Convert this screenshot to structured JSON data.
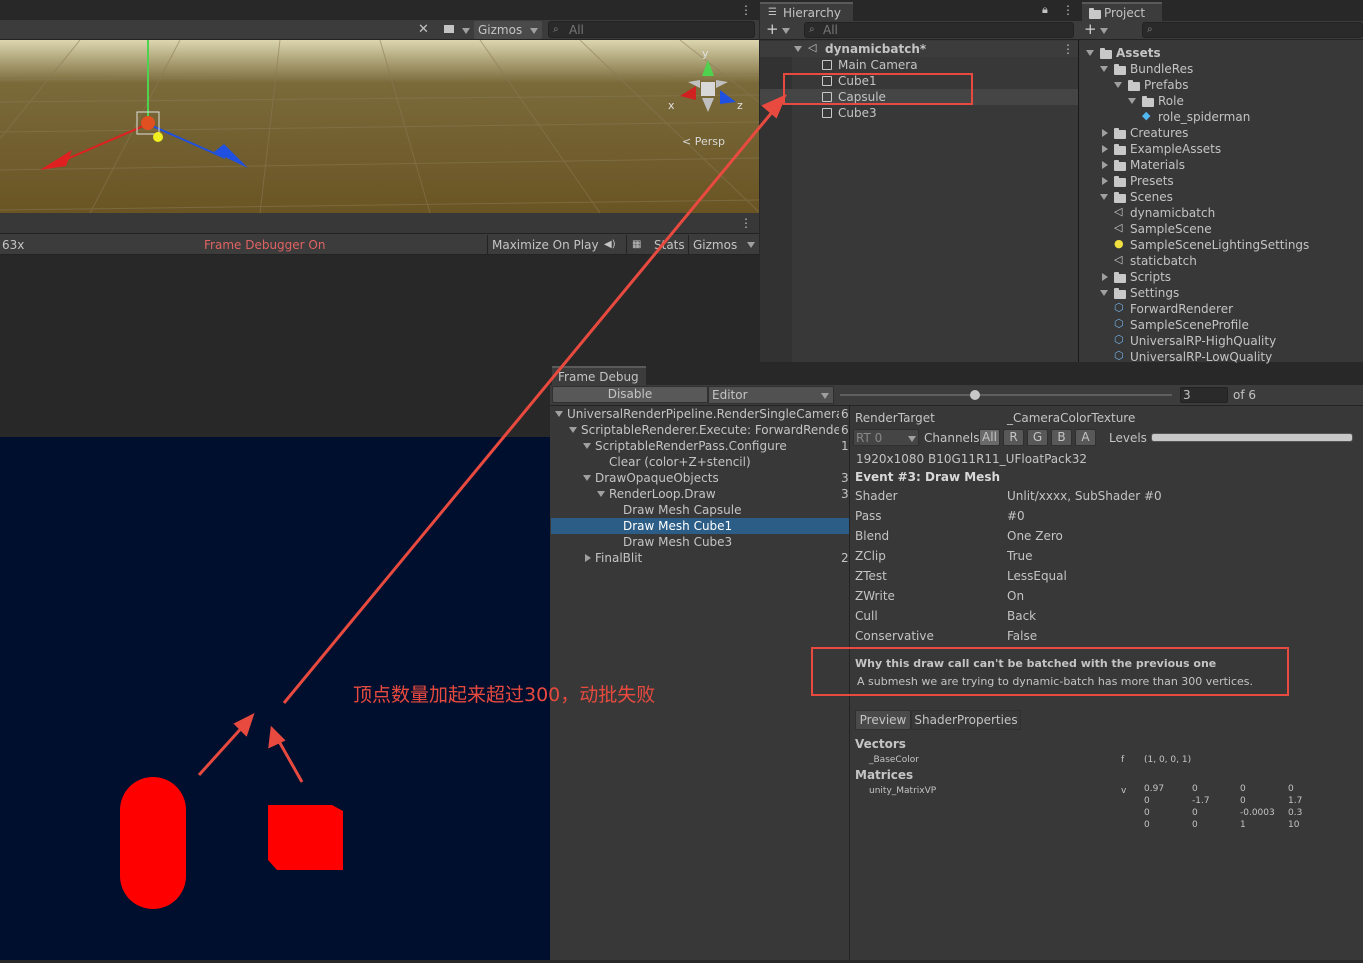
{
  "scene": {
    "toolbar": {
      "gizmos_label": "Gizmos",
      "search_placeholder": "All"
    },
    "axis_y": "y",
    "axis_x": "x",
    "axis_z": "z",
    "persp_label": "< Persp"
  },
  "game": {
    "scale_label": "63x",
    "frame_debugger_label": "Frame Debugger On",
    "maximize_label": "Maximize On Play",
    "stats_label": "Stats",
    "gizmos_label": "Gizmos"
  },
  "hierarchy": {
    "tab_label": "Hierarchy",
    "search_placeholder": "All",
    "scene_name": "dynamicbatch*",
    "items": [
      "Main Camera",
      "Cube1",
      "Capsule",
      "Cube3"
    ]
  },
  "project": {
    "tab_label": "Project",
    "items": [
      {
        "label": "Assets",
        "depth": 0,
        "kind": "folder-open"
      },
      {
        "label": "BundleRes",
        "depth": 1,
        "kind": "folder-open"
      },
      {
        "label": "Prefabs",
        "depth": 2,
        "kind": "folder-open"
      },
      {
        "label": "Role",
        "depth": 3,
        "kind": "folder-open"
      },
      {
        "label": "role_spiderman",
        "depth": 4,
        "kind": "prefab"
      },
      {
        "label": "Creatures",
        "depth": 1,
        "kind": "folder"
      },
      {
        "label": "ExampleAssets",
        "depth": 1,
        "kind": "folder"
      },
      {
        "label": "Materials",
        "depth": 1,
        "kind": "folder"
      },
      {
        "label": "Presets",
        "depth": 1,
        "kind": "folder"
      },
      {
        "label": "Scenes",
        "depth": 1,
        "kind": "folder-open"
      },
      {
        "label": "dynamicbatch",
        "depth": 2,
        "kind": "scene"
      },
      {
        "label": "SampleScene",
        "depth": 2,
        "kind": "scene"
      },
      {
        "label": "SampleSceneLightingSettings",
        "depth": 2,
        "kind": "light"
      },
      {
        "label": "staticbatch",
        "depth": 2,
        "kind": "scene"
      },
      {
        "label": "Scripts",
        "depth": 1,
        "kind": "folder"
      },
      {
        "label": "Settings",
        "depth": 1,
        "kind": "folder-open"
      },
      {
        "label": "ForwardRenderer",
        "depth": 2,
        "kind": "asset"
      },
      {
        "label": "SampleSceneProfile",
        "depth": 2,
        "kind": "asset"
      },
      {
        "label": "UniversalRP-HighQuality",
        "depth": 2,
        "kind": "asset"
      },
      {
        "label": "UniversalRP-LowQuality",
        "depth": 2,
        "kind": "asset"
      }
    ]
  },
  "frame_debug": {
    "tab_label": "Frame Debug",
    "disable_label": "Disable",
    "target_label": "Editor",
    "step_value": "3",
    "of_label": "of 6",
    "tree": [
      {
        "label": "UniversalRenderPipeline.RenderSingleCamera: I",
        "count": "6",
        "depth": 0,
        "fold": true
      },
      {
        "label": "ScriptableRenderer.Execute: ForwardRendere",
        "count": "6",
        "depth": 1,
        "fold": true
      },
      {
        "label": "ScriptableRenderPass.Configure",
        "count": "1",
        "depth": 2,
        "fold": true
      },
      {
        "label": "Clear (color+Z+stencil)",
        "count": "",
        "depth": 3,
        "fold": false
      },
      {
        "label": "DrawOpaqueObjects",
        "count": "3",
        "depth": 2,
        "fold": true
      },
      {
        "label": "RenderLoop.Draw",
        "count": "3",
        "depth": 3,
        "fold": true
      },
      {
        "label": "Draw Mesh Capsule",
        "count": "",
        "depth": 4,
        "fold": false
      },
      {
        "label": "Draw Mesh Cube1",
        "count": "",
        "depth": 4,
        "fold": false
      },
      {
        "label": "Draw Mesh Cube3",
        "count": "",
        "depth": 4,
        "fold": false
      },
      {
        "label": "FinalBlit",
        "count": "2",
        "depth": 2,
        "collapsed": true
      }
    ],
    "render_target_label": "RenderTarget",
    "render_target_value": "_CameraColorTexture",
    "rt_label": "RT 0",
    "channels_label": "Channels",
    "channels": [
      "All",
      "R",
      "G",
      "B",
      "A"
    ],
    "levels_label": "Levels",
    "format": "1920x1080 B10G11R11_UFloatPack32",
    "event_title": "Event #3: Draw Mesh",
    "props": [
      {
        "k": "Shader",
        "v": "Unlit/xxxx, SubShader #0"
      },
      {
        "k": "Pass",
        "v": "#0"
      },
      {
        "k": "Blend",
        "v": "One Zero"
      },
      {
        "k": "ZClip",
        "v": "True"
      },
      {
        "k": "ZTest",
        "v": "LessEqual"
      },
      {
        "k": "ZWrite",
        "v": "On"
      },
      {
        "k": "Cull",
        "v": "Back"
      },
      {
        "k": "Conservative",
        "v": "False"
      }
    ],
    "batch_title": "Why this draw call can't be batched with the previous one",
    "batch_reason": "A submesh we are trying to dynamic-batch has more than 300 vertices.",
    "preview_tab": "Preview",
    "shader_props_tab": "ShaderProperties",
    "vectors_label": "Vectors",
    "base_color_name": "_BaseColor",
    "base_color_type": "f",
    "base_color_value": "(1, 0, 0, 1)",
    "matrices_label": "Matrices",
    "matrix_name": "unity_MatrixVP",
    "matrix_type": "v",
    "matrix": [
      [
        "0.97",
        "0",
        "0",
        "0"
      ],
      [
        "0",
        "-1.7",
        "0",
        "1.7"
      ],
      [
        "0",
        "0",
        "-0.0003",
        "0.3"
      ],
      [
        "0",
        "0",
        "1",
        "10"
      ]
    ]
  },
  "annotation": {
    "text": "顶点数量加起来超过300，动批失败",
    "color": "#e84a3f"
  }
}
